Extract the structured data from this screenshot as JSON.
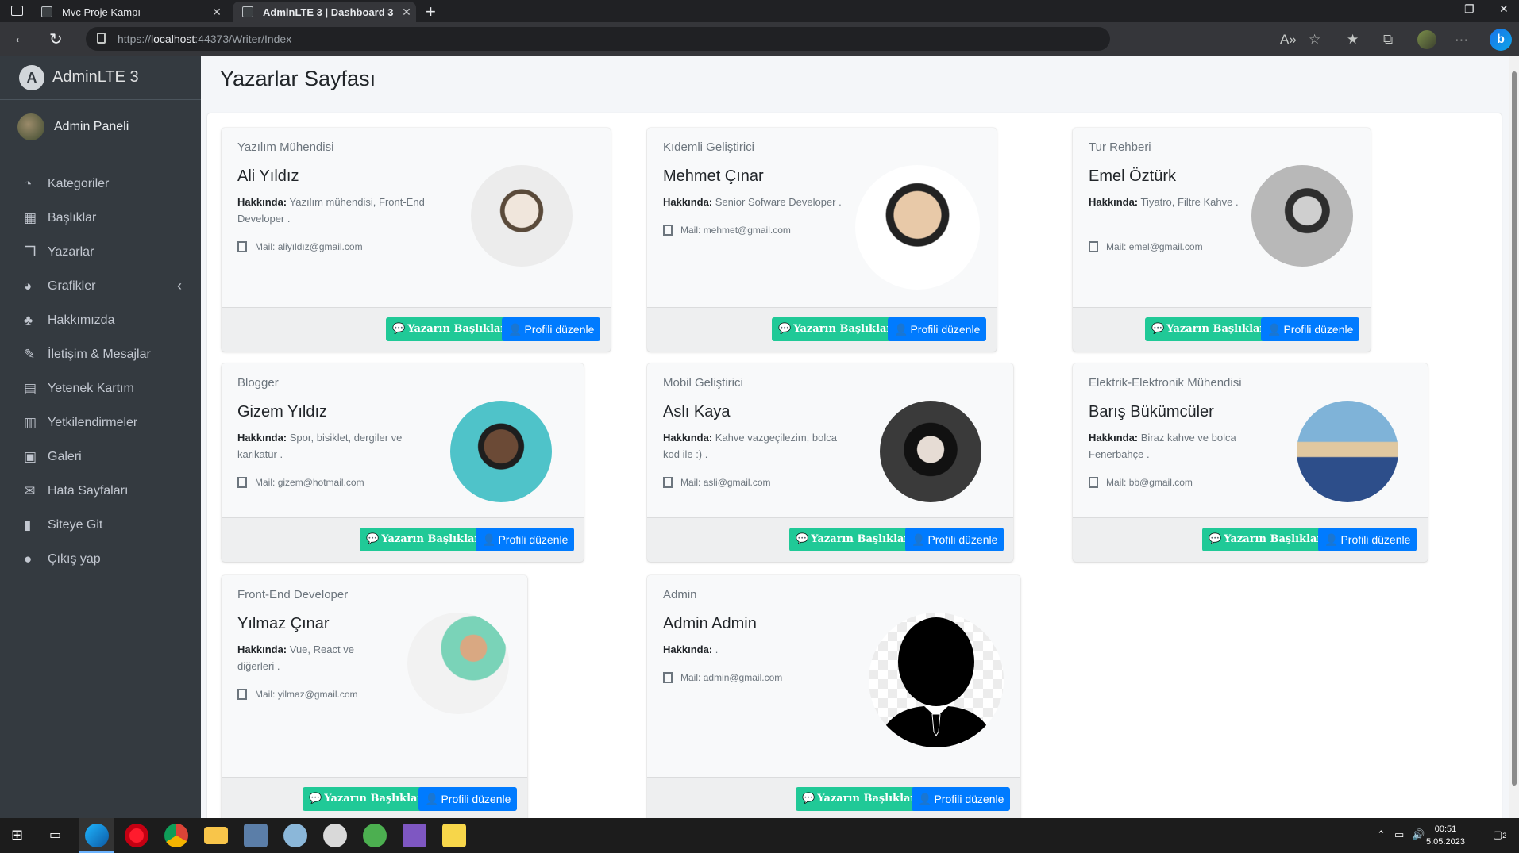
{
  "browser": {
    "tabs": [
      {
        "title": "Mvc Proje Kampı",
        "active": false
      },
      {
        "title": "AdminLTE 3 | Dashboard 3",
        "active": true
      }
    ],
    "url_scheme": "https://",
    "url_host": "localhost",
    "url_rest": ":44373/Writer/Index"
  },
  "sidebar": {
    "brand": "AdminLTE 3",
    "brand_logo": "A",
    "user": "Admin Paneli",
    "items": [
      {
        "label": "Kategoriler",
        "icon": "dashboard-icon"
      },
      {
        "label": "Başlıklar",
        "icon": "grid-icon"
      },
      {
        "label": "Yazarlar",
        "icon": "copy-icon"
      },
      {
        "label": "Grafikler",
        "icon": "pie-chart-icon"
      },
      {
        "label": "Hakkımızda",
        "icon": "tree-icon"
      },
      {
        "label": "İletişim & Mesajlar",
        "icon": "edit-icon"
      },
      {
        "label": "Yetenek Kartım",
        "icon": "table-icon"
      },
      {
        "label": "Yetkilendirmeler",
        "icon": "calendar-icon"
      },
      {
        "label": "Galeri",
        "icon": "image-icon"
      },
      {
        "label": "Hata Sayfaları",
        "icon": "envelope-icon"
      },
      {
        "label": "Siteye Git",
        "icon": "book-icon"
      },
      {
        "label": "Çıkış yap",
        "icon": "apple-icon"
      }
    ]
  },
  "page": {
    "title": "Yazarlar Sayfası"
  },
  "labels": {
    "about": "Hakkında:",
    "mail": "Mail:",
    "titles_button": "Yazarın Başlıkları",
    "edit_button": "Profili düzenle"
  },
  "writers": [
    {
      "role": "Yazılım Mühendisi",
      "name": "Ali Yıldız",
      "about": "Yazılım mühendisi, Front-End Developer .",
      "mail": "aliyıldız@gmail.com"
    },
    {
      "role": "Kıdemli Geliştirici",
      "name": "Mehmet Çınar",
      "about": "Senior Sofware Developer .",
      "mail": "mehmet@gmail.com"
    },
    {
      "role": "Tur Rehberi",
      "name": "Emel Öztürk",
      "about": "Tiyatro, Filtre Kahve .",
      "mail": "emel@gmail.com"
    },
    {
      "role": "Blogger",
      "name": "Gizem Yıldız",
      "about": "Spor, bisiklet, dergiler ve karikatür .",
      "mail": "gizem@hotmail.com"
    },
    {
      "role": "Mobil Geliştirici",
      "name": "Aslı Kaya",
      "about": "Kahve vazgeçilezim, bolca kod ile :) .",
      "mail": "asli@gmail.com"
    },
    {
      "role": "Elektrik-Elektronik Mühendisi",
      "name": "Barış Bükümcüler",
      "about": "Biraz kahve ve bolca Fenerbahçe .",
      "mail": "bb@gmail.com"
    },
    {
      "role": "Front-End Developer",
      "name": "Yılmaz Çınar",
      "about": "Vue, React ve diğerleri .",
      "mail": "yilmaz@gmail.com"
    },
    {
      "role": "Admin",
      "name": "Admin Admin",
      "about": ".",
      "mail": "admin@gmail.com"
    }
  ],
  "taskbar": {
    "time": "00:51",
    "date": "5.05.2023",
    "notifications": "2"
  }
}
